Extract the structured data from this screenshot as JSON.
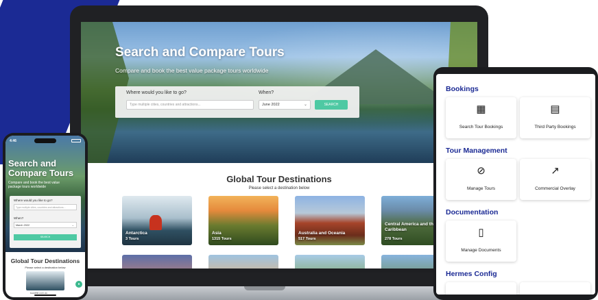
{
  "laptop": {
    "hero": {
      "title": "Search and Compare Tours",
      "subtitle": "Compare and book the best value package tours worldwide"
    },
    "search": {
      "where_label": "Where would you like to go?",
      "where_placeholder": "Type multiple cities, countries and attractions...",
      "when_label": "When?",
      "when_value": "June 2022",
      "button_label": "SEARCH"
    },
    "section": {
      "title": "Global Tour Destinations",
      "subtitle": "Please select a destination below"
    },
    "destinations": [
      {
        "name": "Antarctica",
        "count": "3 Tours"
      },
      {
        "name": "Asia",
        "count": "1315 Tours"
      },
      {
        "name": "Australia and Oceania",
        "count": "517 Tours"
      },
      {
        "name": "Central America and the Caribbean",
        "count": "278 Tours"
      }
    ]
  },
  "phone": {
    "status_time": "4:46",
    "hero": {
      "title": "Search and Compare Tours",
      "subtitle": "Compare and book the best value package tours worldwide"
    },
    "search": {
      "where_label": "Where would you like to go?",
      "where_placeholder": "Type multiple cities, countries and attractions...",
      "when_label": "When?",
      "when_value": "March 2022",
      "button_label": "SEARCH"
    },
    "section": {
      "title": "Global Tour Destinations",
      "subtitle": "Please select a destination below"
    },
    "url": "tourdfile.com.au"
  },
  "tablet": {
    "sections": [
      {
        "title": "Bookings",
        "tiles": [
          {
            "label": "Search Tour Bookings",
            "icon": "building-icon"
          },
          {
            "label": "Third Party Bookings",
            "icon": "receipt-icon"
          }
        ]
      },
      {
        "title": "Tour Management",
        "tiles": [
          {
            "label": "Manage Tours",
            "icon": "compass-icon"
          },
          {
            "label": "Commercial Overlay",
            "icon": "trending-up-icon"
          }
        ]
      },
      {
        "title": "Documentation",
        "tiles": [
          {
            "label": "Manage Documents",
            "icon": "document-icon"
          }
        ]
      },
      {
        "title": "Hermes Config",
        "tiles": []
      }
    ]
  },
  "colors": {
    "brand_navy": "#1b2a94",
    "accent_green": "#4ec9a3"
  }
}
